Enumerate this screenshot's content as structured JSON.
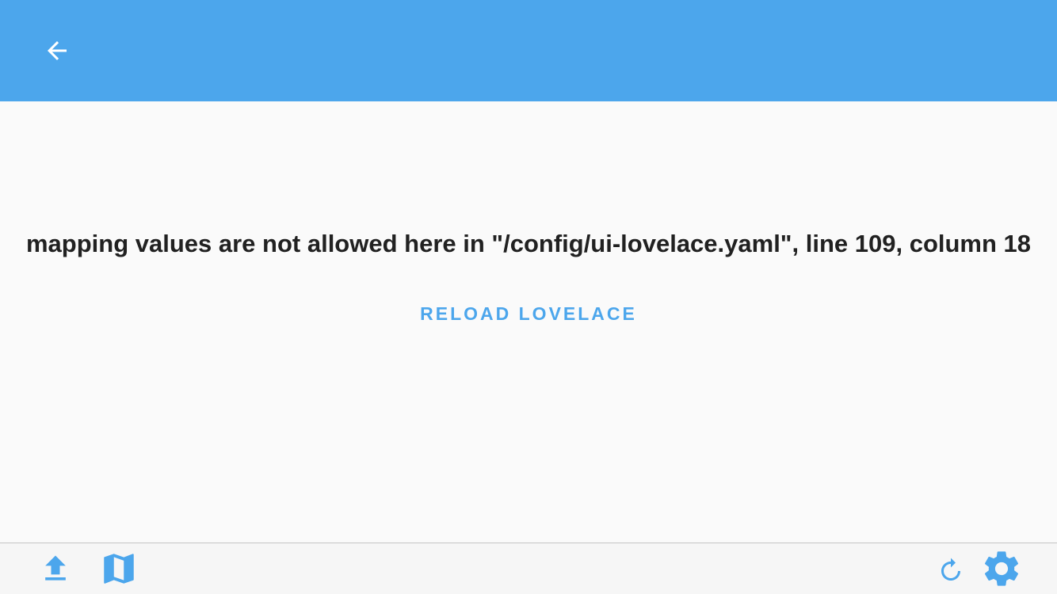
{
  "header": {
    "back_icon": "arrow-left-icon",
    "background_color": "#4ca6ec"
  },
  "error": {
    "message": "mapping values are not allowed here in \"/config/ui-lovelace.yaml\", line 109, column 18",
    "reload_label": "RELOAD LOVELACE",
    "accent_color": "#4ca6ec"
  },
  "bottom_bar": {
    "left_icons": [
      "upload-icon",
      "map-icon"
    ],
    "right_icons": [
      "refresh-icon",
      "settings-gear-icon"
    ],
    "icon_color": "#4ca6ec"
  }
}
